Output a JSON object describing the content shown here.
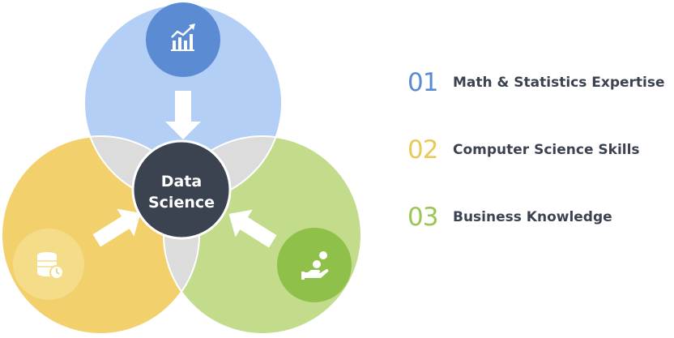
{
  "center": {
    "line1": "Data",
    "line2": "Science"
  },
  "colors": {
    "blue_circle": "#b3cff5",
    "blue_badge": "#5b8bd3",
    "yellow_circle": "#f2d06b",
    "yellow_badge": "#f5dc88",
    "green_circle": "#c3dc8c",
    "green_badge": "#8ec04a",
    "overlap": "#dcdcdc",
    "center": "#3b4250"
  },
  "icons": {
    "top": "bar-chart-trend-icon",
    "left": "database-clock-icon",
    "right": "hand-coins-icon"
  },
  "legend": [
    {
      "number": "01",
      "label": "Math & Statistics Expertise",
      "color": "#5b8bd3"
    },
    {
      "number": "02",
      "label": "Computer Science Skills",
      "color": "#e9c95a"
    },
    {
      "number": "03",
      "label": "Business Knowledge",
      "color": "#9cc653"
    }
  ]
}
